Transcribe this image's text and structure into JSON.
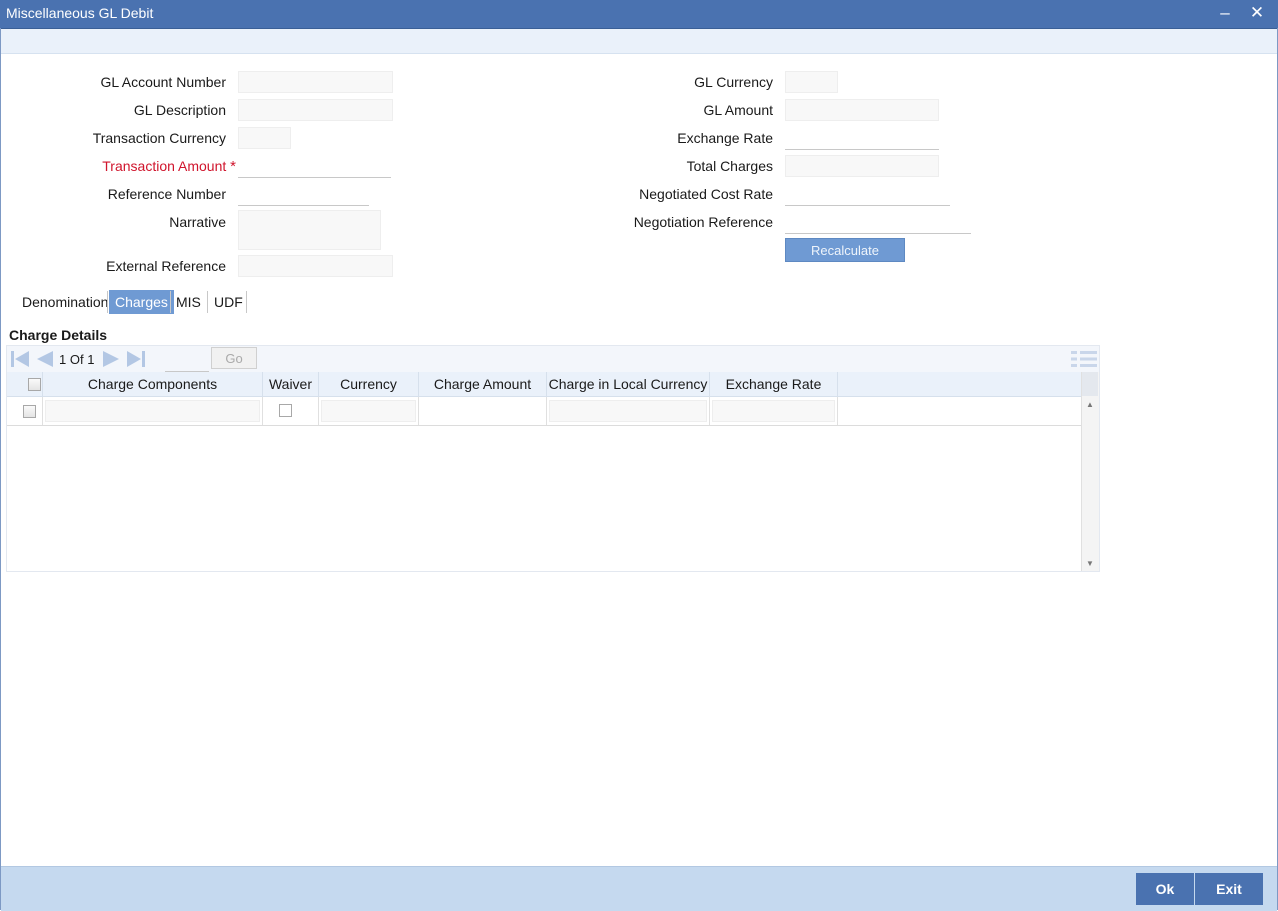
{
  "window": {
    "title": "Miscellaneous GL Debit",
    "minimize_glyph": "–",
    "close_glyph": "✕"
  },
  "form": {
    "left": [
      {
        "label": "GL Account Number",
        "value": ""
      },
      {
        "label": "GL Description",
        "value": ""
      },
      {
        "label": "Transaction Currency",
        "value": ""
      },
      {
        "label": "Transaction Amount",
        "required_mark": "*",
        "value": ""
      },
      {
        "label": "Reference Number",
        "value": ""
      },
      {
        "label": "Narrative",
        "value": ""
      },
      {
        "label": "External Reference",
        "value": ""
      }
    ],
    "right": [
      {
        "label": "GL Currency",
        "value": ""
      },
      {
        "label": "GL Amount",
        "value": ""
      },
      {
        "label": "Exchange Rate",
        "value": ""
      },
      {
        "label": "Total Charges",
        "value": ""
      },
      {
        "label": "Negotiated Cost Rate",
        "value": ""
      },
      {
        "label": "Negotiation Reference",
        "value": ""
      }
    ],
    "recalculate_label": "Recalculate"
  },
  "tabs": [
    {
      "label": "Denomination"
    },
    {
      "label": "Charges",
      "active": true
    },
    {
      "label": "MIS"
    },
    {
      "label": "UDF"
    }
  ],
  "charge_details": {
    "title": "Charge Details",
    "pager": {
      "current": "1",
      "of_label": "Of",
      "total": "1",
      "go_label": "Go",
      "page_input": ""
    },
    "columns": [
      "Charge Components",
      "Waiver",
      "Currency",
      "Charge Amount",
      "Charge in Local Currency",
      "Exchange Rate"
    ],
    "rows": [
      {
        "charge_component": "",
        "waiver": false,
        "currency": "",
        "charge_amount": "",
        "local_currency_charge": "",
        "exchange_rate": ""
      }
    ]
  },
  "footer": {
    "ok_label": "Ok",
    "exit_label": "Exit"
  },
  "colors": {
    "titlebar": "#4a72b0",
    "accent": "#6f9ad3",
    "required": "#d0142c",
    "footer": "#c5d9ef"
  },
  "icons": [
    "minimize-icon",
    "close-icon",
    "first-page-icon",
    "previous-page-icon",
    "next-page-icon",
    "last-page-icon",
    "list-view-icon"
  ]
}
